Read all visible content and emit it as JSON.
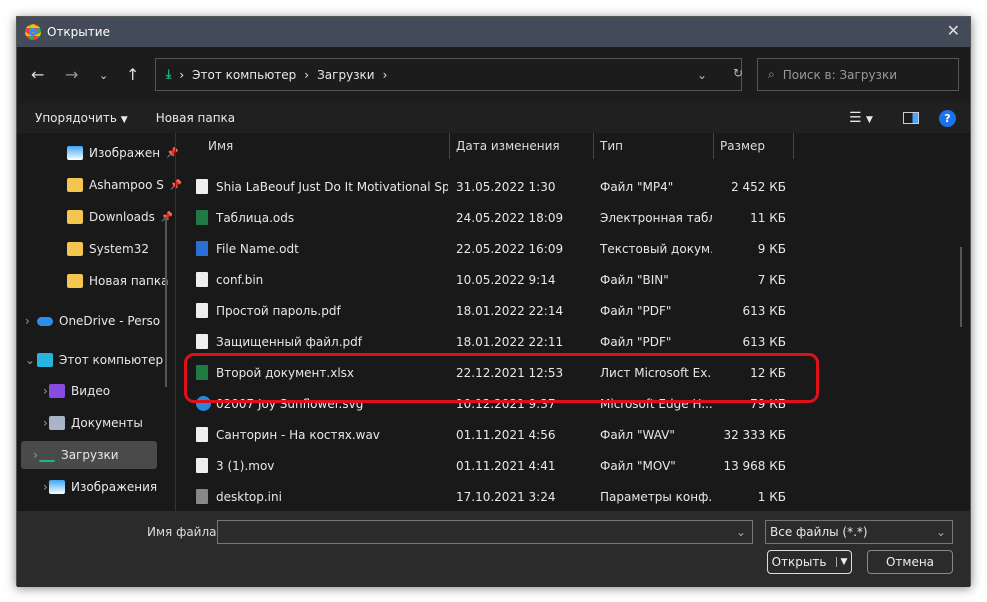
{
  "window": {
    "title": "Открытие"
  },
  "nav": {
    "breadcrumb": [
      "Этот компьютер",
      "Загрузки"
    ],
    "search_placeholder": "Поиск в: Загрузки"
  },
  "toolbar": {
    "organize": "Упорядочить",
    "new_folder": "Новая папка"
  },
  "sidebar": {
    "items": [
      {
        "label": "Изображен",
        "icon": "pictures-icon",
        "pinned": true
      },
      {
        "label": "Ashampoo S",
        "icon": "folder-icon",
        "pinned": true
      },
      {
        "label": "Downloads",
        "icon": "folder-icon",
        "pinned": true
      },
      {
        "label": "System32",
        "icon": "folder-icon"
      },
      {
        "label": "Новая папка",
        "icon": "folder-icon"
      },
      {
        "label": "OneDrive - Perso",
        "icon": "onedrive-icon"
      },
      {
        "label": "Этот компьютер",
        "icon": "computer-icon"
      },
      {
        "label": "Видео",
        "icon": "video-icon"
      },
      {
        "label": "Документы",
        "icon": "documents-icon"
      },
      {
        "label": "Загрузки",
        "icon": "download-icon",
        "selected": true
      },
      {
        "label": "Изображения",
        "icon": "pictures-icon"
      }
    ]
  },
  "columns": {
    "name": "Имя",
    "date": "Дата изменения",
    "type": "Тип",
    "size": "Размер"
  },
  "files": [
    {
      "name": "Shia LaBeouf Just Do It Motivational Spee...",
      "date": "31.05.2022 1:30",
      "type": "Файл \"MP4\"",
      "size": "2 452 КБ",
      "icon": "media-icon"
    },
    {
      "name": "Таблица.ods",
      "date": "24.05.2022 18:09",
      "type": "Электронная табл...",
      "size": "11 КБ",
      "icon": "excel-icon"
    },
    {
      "name": "File Name.odt",
      "date": "22.05.2022 16:09",
      "type": "Текстовый докум...",
      "size": "9 КБ",
      "icon": "word-icon"
    },
    {
      "name": "conf.bin",
      "date": "10.05.2022 9:14",
      "type": "Файл \"BIN\"",
      "size": "7 КБ",
      "icon": "file-icon"
    },
    {
      "name": "Простой пароль.pdf",
      "date": "18.01.2022 22:14",
      "type": "Файл \"PDF\"",
      "size": "613 КБ",
      "icon": "pdf-icon"
    },
    {
      "name": "Защищенный файл.pdf",
      "date": "18.01.2022 22:11",
      "type": "Файл \"PDF\"",
      "size": "613 КБ",
      "icon": "pdf-icon"
    },
    {
      "name": "Второй документ.xlsx",
      "date": "22.12.2021 12:53",
      "type": "Лист Microsoft Ex...",
      "size": "12 КБ",
      "icon": "excel-icon",
      "highlighted": true
    },
    {
      "name": "02007 Joy Sunflower.svg",
      "date": "10.12.2021 9:37",
      "type": "Microsoft Edge H...",
      "size": "79 КБ",
      "icon": "edge-icon"
    },
    {
      "name": "Санторин - На костях.wav",
      "date": "01.11.2021 4:56",
      "type": "Файл \"WAV\"",
      "size": "32 333 КБ",
      "icon": "media-icon"
    },
    {
      "name": "3 (1).mov",
      "date": "01.11.2021 4:41",
      "type": "Файл \"MOV\"",
      "size": "13 968 КБ",
      "icon": "media-icon"
    },
    {
      "name": "desktop.ini",
      "date": "17.10.2021 3:24",
      "type": "Параметры конф...",
      "size": "1 КБ",
      "icon": "settings-file-icon"
    }
  ],
  "footer": {
    "filename_label": "Имя файла:",
    "filename_value": "",
    "filter": "Все файлы (*.*)",
    "open": "Открыть",
    "cancel": "Отмена"
  },
  "colors": {
    "accent": "#1fb590",
    "highlight": "#e0101a"
  }
}
